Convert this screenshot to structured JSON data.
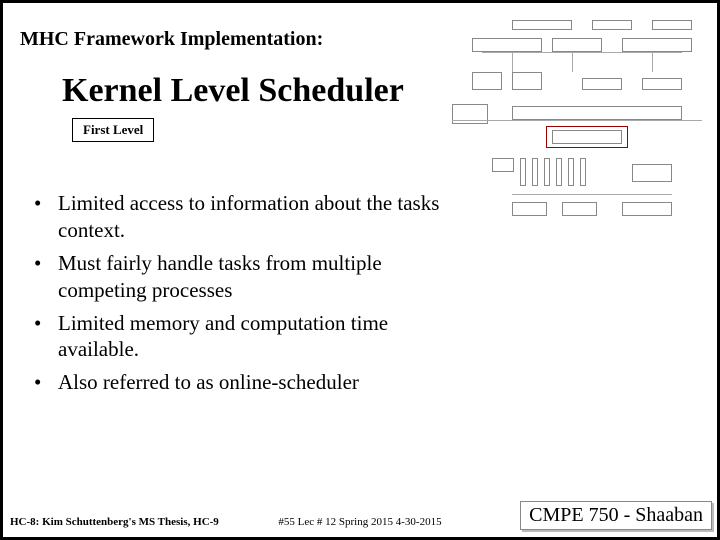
{
  "header": {
    "framework": "MHC Framework Implementation:"
  },
  "title": "Kernel Level Scheduler",
  "level_box": "First Level",
  "bullets": [
    "Limited access to information about the tasks context.",
    "Must fairly handle tasks from multiple competing processes",
    "Limited memory and computation time available.",
    "Also referred to as online-scheduler"
  ],
  "footer": {
    "left": "HC-8: Kim Schuttenberg's MS Thesis, HC-9",
    "center": "#55  Lec # 12  Spring 2015  4-30-2015",
    "right": "CMPE 750 - Shaaban"
  }
}
